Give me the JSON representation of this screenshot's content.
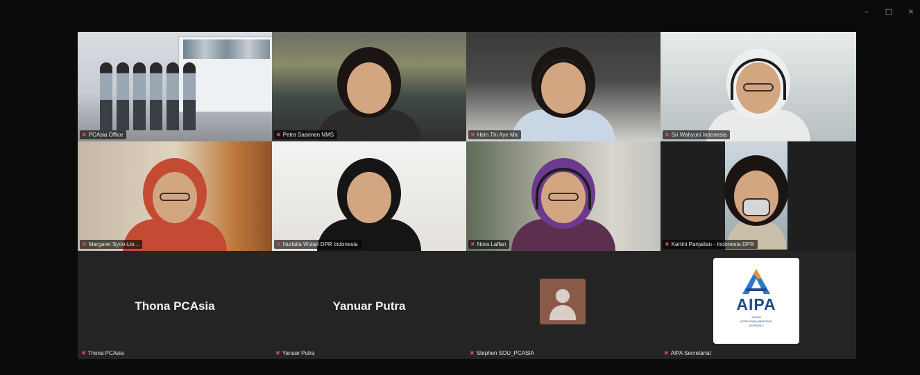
{
  "window": {
    "minimize_icon": "minimize-icon",
    "maximize_icon": "maximize-icon",
    "close_icon": "close-icon",
    "controls": {
      "minimize": "–",
      "maximize": "□",
      "close": "×"
    }
  },
  "participants": [
    {
      "name": "PCAsia Office",
      "muted": true,
      "type": "video"
    },
    {
      "name": "Petra Saarinen NMS",
      "muted": true,
      "type": "video"
    },
    {
      "name": "Hein Thi Aye Ma",
      "muted": true,
      "type": "video"
    },
    {
      "name": "Sri Wahyuni Indonesia",
      "muted": true,
      "type": "video"
    },
    {
      "name": "Margaret Syoo-Lin...",
      "muted": true,
      "type": "video"
    },
    {
      "name": "Nurlaila Wulan DPR Indonesia",
      "muted": true,
      "type": "video"
    },
    {
      "name": "Nora Laffan",
      "muted": true,
      "type": "video"
    },
    {
      "name": "Kartini Panjaitan - Indonesia DPR",
      "muted": true,
      "type": "video"
    },
    {
      "name": "Thona PCAsia",
      "display": "Thona PCAsia",
      "muted": true,
      "type": "name-only"
    },
    {
      "name": "Yanuar Putra",
      "display": "Yanuar Putra",
      "muted": true,
      "type": "name-only"
    },
    {
      "name": "Stephen SOU_PCASIA",
      "muted": true,
      "type": "avatar"
    },
    {
      "name": "AIPA Secretariat",
      "muted": true,
      "type": "logo"
    }
  ],
  "aipa_logo": {
    "title": "AIPA",
    "subtitle_lines": [
      "ASEAN",
      "INTER-PARLIAMENTARY",
      "ASSEMBLY"
    ],
    "colors": {
      "navy": "#1c4c86",
      "blue": "#2f78c9",
      "orange": "#f0913a"
    }
  },
  "colors": {
    "active_speaker": "#2fd06a",
    "muted_icon": "#e5484d",
    "tile_bg": "#1f1f1f"
  },
  "icons": {
    "muted": "mic-off-icon",
    "avatar": "person-placeholder-icon"
  }
}
